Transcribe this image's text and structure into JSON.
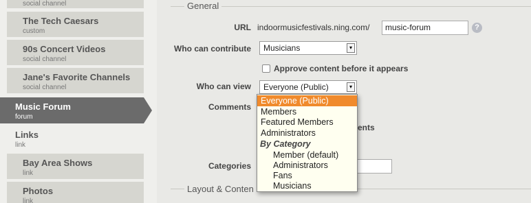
{
  "sidebar": {
    "top_partial_kind": "social channel",
    "items": [
      {
        "title": "The Tech Caesars",
        "kind": "custom"
      },
      {
        "title": "90s Concert Videos",
        "kind": "social channel"
      },
      {
        "title": "Jane's Favorite Channels",
        "kind": "social channel"
      },
      {
        "title": "Music Forum",
        "kind": "forum"
      },
      {
        "title": "Links",
        "kind": "link"
      },
      {
        "title": "Bay Area Shows",
        "kind": "link"
      },
      {
        "title": "Photos",
        "kind": "link"
      }
    ]
  },
  "general": {
    "legend": "General",
    "url_label": "URL",
    "url_prefix": "indoormusicfestivals.ning.com/",
    "url_value": "music-forum",
    "help_icon": "?",
    "contribute_label": "Who can contribute",
    "contribute_value": "Musicians",
    "approve_label": "Approve content before it appears",
    "view_label": "Who can view",
    "view_value": "Everyone (Public)",
    "comments_label": "Comments",
    "comments_partial": "ents",
    "categories_label": "Categories"
  },
  "layout": {
    "legend": "Layout & Conten"
  },
  "dropdown": {
    "selected": "Everyone (Public)",
    "options": [
      "Members",
      "Featured Members",
      "Administrators"
    ],
    "group_label": "By Category",
    "group_options": [
      "Member (default)",
      "Administrators",
      "Fans",
      "Musicians"
    ]
  }
}
